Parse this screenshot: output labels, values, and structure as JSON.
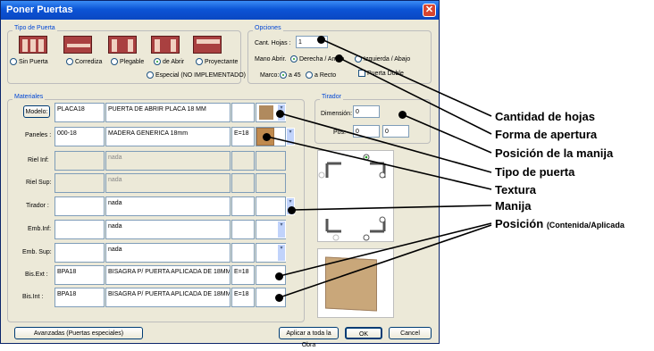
{
  "window": {
    "title": "Poner Puertas",
    "close_glyph": "✕"
  },
  "tipo_puerta": {
    "title": "Tipo de Puerta",
    "options": [
      "Sin Puerta",
      "Corrediza",
      "Plegable",
      "de Abrir",
      "Proyectante"
    ],
    "special": "Especial (NO IMPLEMENTADO)",
    "selected": "de Abrir"
  },
  "opciones": {
    "title": "Opciones",
    "cant_hojas_label": "Cant. Hojas :",
    "cant_hojas_value": "1",
    "mano_label": "Mano Abrir.",
    "mano_options": [
      "Derecha / Arriba",
      "Izquierda / Abajo"
    ],
    "marco_label": "Marco:",
    "marco_options": [
      "a 45",
      "a Recto"
    ],
    "puerta_doble": "Puerta Doble"
  },
  "materiales": {
    "title": "Materiales",
    "rows": [
      {
        "label": "Modelo:",
        "code": "PLACA18",
        "desc": "PUERTA DE ABRIR PLACA 18 MM",
        "esp": ""
      },
      {
        "label": "Paneles :",
        "code": "000-18",
        "desc": "MADERA GENERICA 18mm",
        "esp": "E=18"
      },
      {
        "label": "Riel Inf:",
        "code": "",
        "desc": "nada",
        "esp": ""
      },
      {
        "label": "Riel Sup:",
        "code": "",
        "desc": "nada",
        "esp": ""
      },
      {
        "label": "Tirador :",
        "code": "",
        "desc": "nada",
        "esp": ""
      },
      {
        "label": "Emb.Inf:",
        "code": "",
        "desc": "nada",
        "esp": ""
      },
      {
        "label": "Emb. Sup:",
        "code": "",
        "desc": "nada",
        "esp": ""
      },
      {
        "label": "Bis.Ext :",
        "code": "BPA18",
        "desc": "BISAGRA P/ PUERTA APLICADA DE 18MM",
        "esp": "E=18"
      },
      {
        "label": "Bis.Int :",
        "code": "BPA18",
        "desc": "BISAGRA P/ PUERTA APLICADA DE 18MM",
        "esp": "E=18"
      }
    ]
  },
  "tirador": {
    "title": "Tirador",
    "dimension_label": "Dimensión:",
    "dimension_value": "0",
    "pos_label": "Pos:",
    "pos_x": "0",
    "pos_y": "0"
  },
  "buttons": {
    "avanzadas": "Avanzadas (Puertas especiales)",
    "aplicar": "Aplicar a toda la Obra",
    "ok": "OK",
    "cancel": "Cancel"
  },
  "annotations": [
    "Cantidad de hojas",
    "Forma de apertura",
    "Posición de la manija",
    "Tipo de puerta",
    "Textura",
    "Manija",
    "Posición"
  ],
  "annotation_suffix": "(Contenida/Aplicada",
  "colors": {
    "title_bar": "#0a47c2",
    "accent_label": "#0046d5",
    "texture": "#c08a4e"
  }
}
